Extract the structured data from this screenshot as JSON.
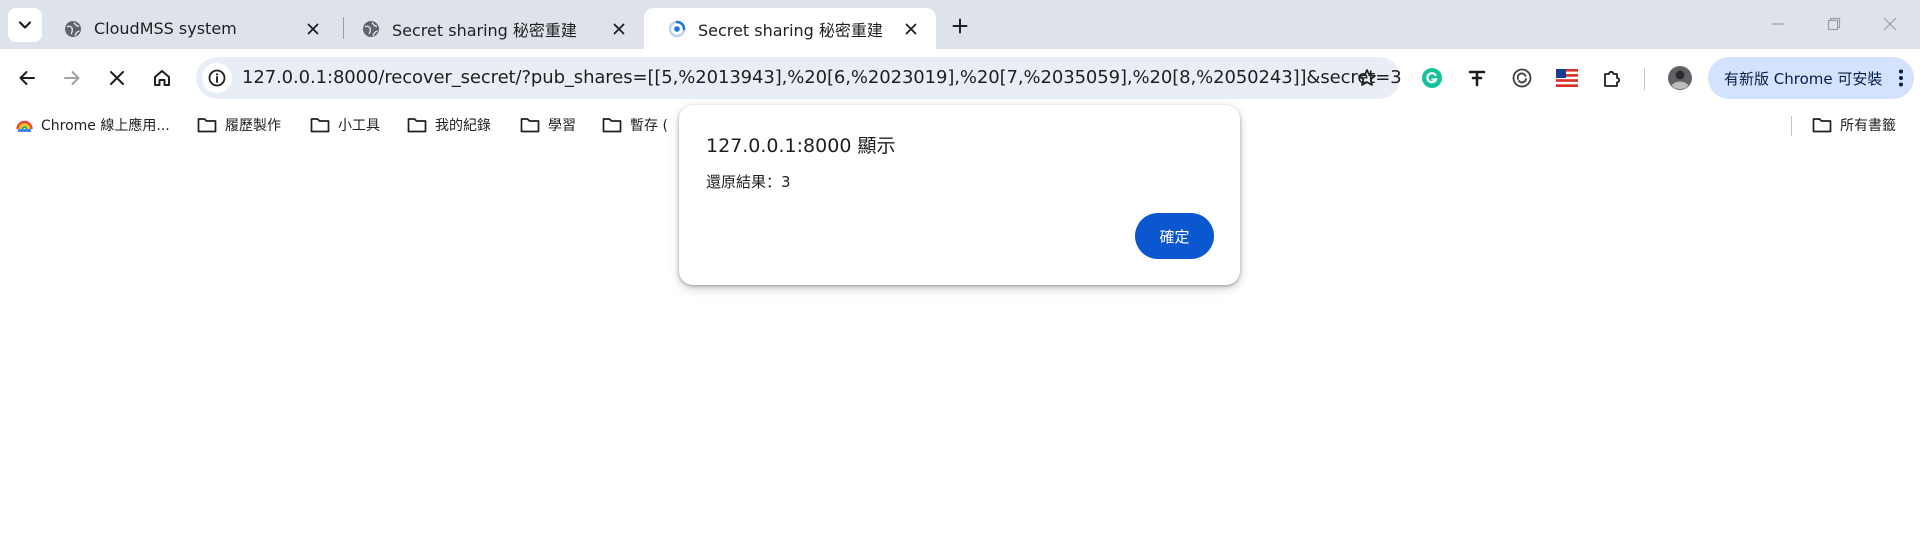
{
  "tabs": [
    {
      "title": "CloudMSS system",
      "active": false
    },
    {
      "title": "Secret sharing 秘密重建",
      "active": false
    },
    {
      "title": "Secret sharing 秘密重建",
      "active": true
    }
  ],
  "toolbar": {
    "url": "127.0.0.1:8000/recover_secret/?pub_shares=[[5,%2013943],%20[6,%2023019],%20[7,%2035059],%20[8,%2050243]]&secret=3",
    "update_label": "有新版 Chrome 可安裝"
  },
  "bookmarks": {
    "items": [
      {
        "label": "Chrome 線上應用...",
        "icon": "chrome-webstore-icon"
      },
      {
        "label": "履歷製作",
        "icon": "folder-icon"
      },
      {
        "label": "小工具",
        "icon": "folder-icon"
      },
      {
        "label": "我的紀錄",
        "icon": "folder-icon"
      },
      {
        "label": "學習",
        "icon": "folder-icon"
      },
      {
        "label": "暫存 (",
        "icon": "folder-icon"
      }
    ],
    "all_bookmarks": "所有書籤"
  },
  "dialog": {
    "title": "127.0.0.1:8000 顯示",
    "message": "還原結果：3",
    "ok_label": "確定"
  },
  "colors": {
    "tabstrip": "#dee3eb",
    "omnibox": "#e9eef6",
    "accent_button": "#0b57d0",
    "update_chip": "#d3e3fd"
  }
}
